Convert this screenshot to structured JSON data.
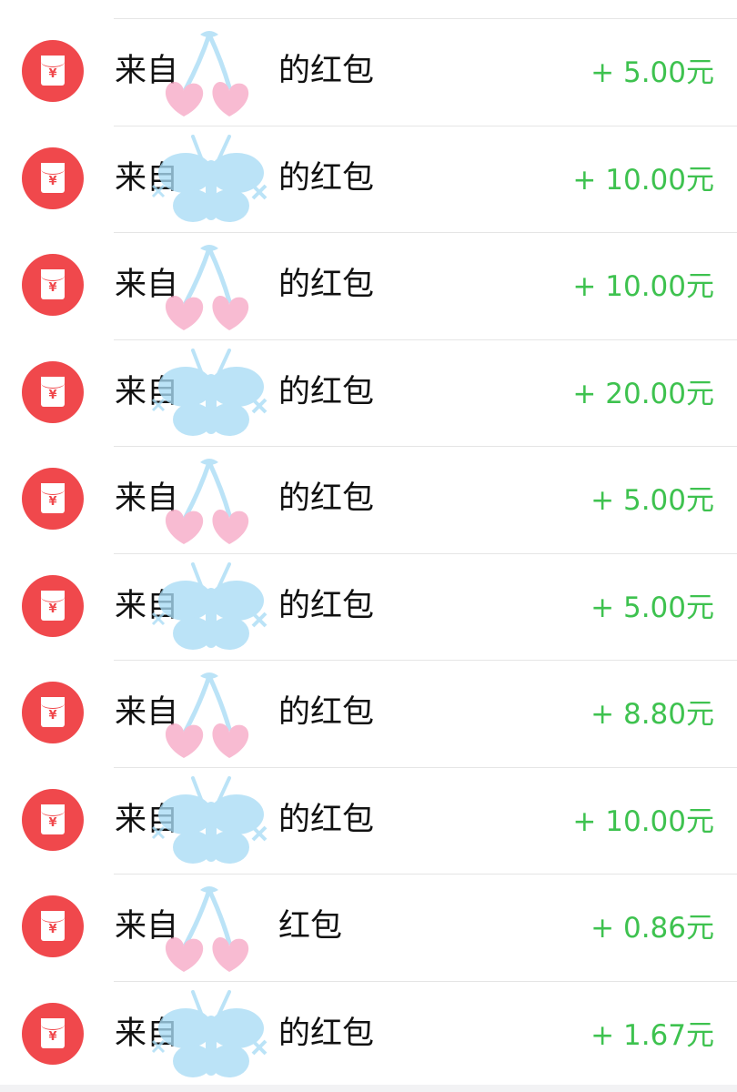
{
  "colors": {
    "icon_red": "#f0484c",
    "amount_green": "#3ec24f",
    "separator": "#e5e5e5",
    "sticker_pink": "#f7a9c6",
    "sticker_blue": "#a9dcf5"
  },
  "items": [
    {
      "title_prefix": "来自",
      "title_suffix": "的红包",
      "amount": "+ 5.00元",
      "sticker": "cherry-sticker"
    },
    {
      "title_prefix": "来自",
      "title_suffix": "的红包",
      "amount": "+ 10.00元",
      "sticker": "butterfly-sticker"
    },
    {
      "title_prefix": "来自",
      "title_suffix": "的红包",
      "amount": "+ 10.00元",
      "sticker": "cherry-sticker"
    },
    {
      "title_prefix": "来自",
      "title_suffix": "的红包",
      "amount": "+ 20.00元",
      "sticker": "butterfly-sticker"
    },
    {
      "title_prefix": "来自",
      "title_suffix": "的红包",
      "amount": "+ 5.00元",
      "sticker": "cherry-sticker"
    },
    {
      "title_prefix": "来自",
      "title_suffix": "的红包",
      "amount": "+ 5.00元",
      "sticker": "butterfly-sticker"
    },
    {
      "title_prefix": "来自",
      "title_suffix": "的红包",
      "amount": "+ 8.80元",
      "sticker": "cherry-sticker"
    },
    {
      "title_prefix": "来自",
      "title_suffix": "的红包",
      "amount": "+ 10.00元",
      "sticker": "butterfly-sticker"
    },
    {
      "title_prefix": "来自",
      "title_suffix": "红包",
      "amount": "+ 0.86元",
      "sticker": "cherry-sticker"
    },
    {
      "title_prefix": "来自",
      "title_suffix": "的红包",
      "amount": "+ 1.67元",
      "sticker": "butterfly-sticker"
    }
  ]
}
